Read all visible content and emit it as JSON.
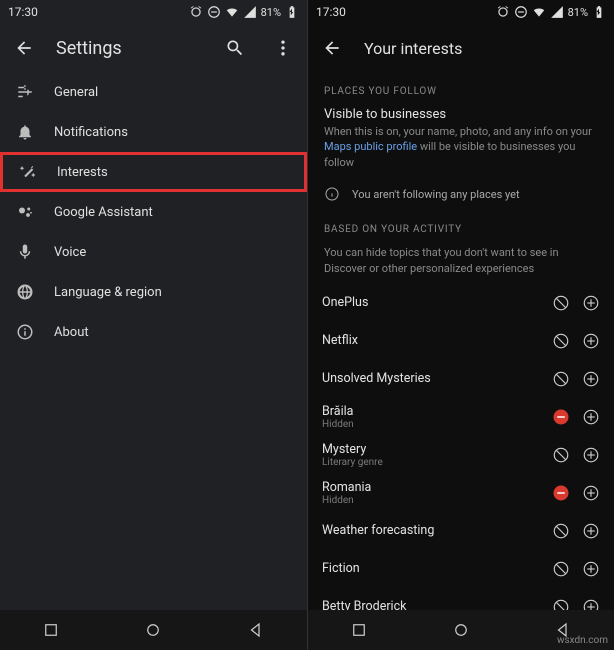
{
  "left": {
    "status": {
      "time": "17:30",
      "battery": "81%"
    },
    "title": "Settings",
    "items": [
      {
        "label": "General"
      },
      {
        "label": "Notifications"
      },
      {
        "label": "Interests"
      },
      {
        "label": "Google Assistant"
      },
      {
        "label": "Voice"
      },
      {
        "label": "Language & region"
      },
      {
        "label": "About"
      }
    ]
  },
  "right": {
    "status": {
      "time": "17:30",
      "battery": "81%"
    },
    "title": "Your interests",
    "places": {
      "header": "PLACES YOU FOLLOW",
      "subtitle": "Visible to businesses",
      "desc_pre": "When this is on, your name, photo, and any info on your ",
      "desc_link": "Maps public profile",
      "desc_post": " will be visible to businesses you follow",
      "empty": "You aren't following any places yet"
    },
    "activity": {
      "header": "BASED ON YOUR ACTIVITY",
      "desc": "You can hide topics that you don't want to see in Discover or other personalized experiences"
    },
    "topics": [
      {
        "title": "OnePlus",
        "sub": "",
        "state": "normal"
      },
      {
        "title": "Netflix",
        "sub": "",
        "state": "normal"
      },
      {
        "title": "Unsolved Mysteries",
        "sub": "",
        "state": "normal"
      },
      {
        "title": "Brăila",
        "sub": "Hidden",
        "state": "hidden"
      },
      {
        "title": "Mystery",
        "sub": "Literary genre",
        "state": "normal"
      },
      {
        "title": "Romania",
        "sub": "Hidden",
        "state": "hidden"
      },
      {
        "title": "Weather forecasting",
        "sub": "",
        "state": "normal"
      },
      {
        "title": "Fiction",
        "sub": "",
        "state": "normal"
      },
      {
        "title": "Betty Broderick",
        "sub": "",
        "state": "normal"
      }
    ]
  },
  "watermark": "wsxdn.com"
}
